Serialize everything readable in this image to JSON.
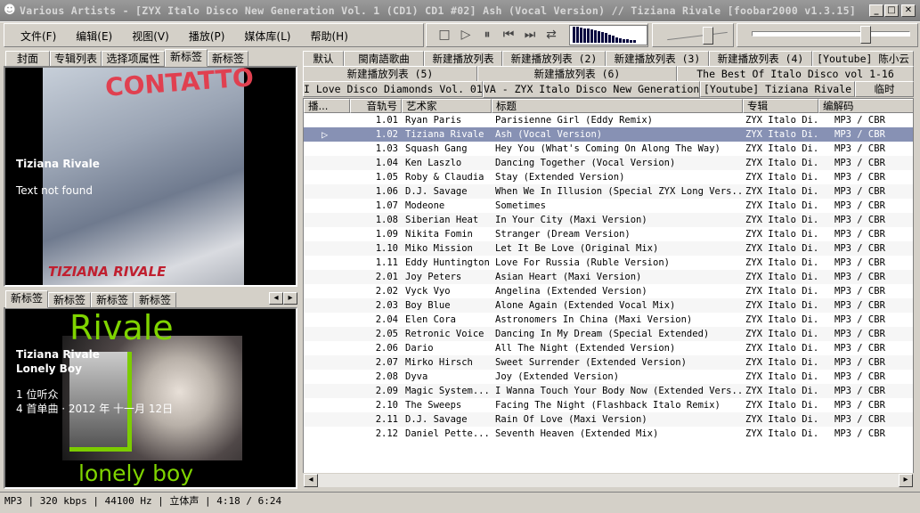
{
  "window": {
    "title": "Various Artists - [ZYX Italo Disco New Generation Vol. 1 (CD1) CD1 #02] Ash (Vocal Version) // Tiziana Rivale   [foobar2000 v1.3.15]"
  },
  "menu": [
    "文件(F)",
    "编辑(E)",
    "视图(V)",
    "播放(P)",
    "媒体库(L)",
    "帮助(H)"
  ],
  "left_tabs_top": [
    {
      "label": "封面"
    },
    {
      "label": "专辑列表"
    },
    {
      "label": "选择项属性"
    },
    {
      "label": "新标签",
      "active": true
    },
    {
      "label": "新标签"
    }
  ],
  "cover_overlay": {
    "artist": "Tiziana Rivale",
    "status": "Text not found"
  },
  "left_tabs_bottom": [
    {
      "label": "新标签",
      "active": true
    },
    {
      "label": "新标签"
    },
    {
      "label": "新标签"
    },
    {
      "label": "新标签"
    }
  ],
  "artist_panel": {
    "artist": "Tiziana Rivale",
    "track": "Lonely Boy",
    "listeners": "1 位听众",
    "info": "4 首单曲 · 2012 年 十一月 12日"
  },
  "playlist_tabs": {
    "row1": [
      "默认",
      "閩南語歌曲",
      "新建播放列表",
      "新建播放列表 (2)",
      "新建播放列表 (3)",
      "新建播放列表 (4)",
      "[Youtube] 陈小云"
    ],
    "row2": [
      "新建播放列表 (5)",
      "新建播放列表 (6)",
      "The Best Of Italo Disco vol 1-16"
    ],
    "row3": [
      "I Love Disco Diamonds Vol. 01",
      "VA - ZYX Italo Disco New Generation",
      "[Youtube] Tiziana Rivale",
      "临时"
    ],
    "active": "VA - ZYX Italo Disco New Generation"
  },
  "columns": [
    "播...",
    "音轨号",
    "艺术家",
    "标题",
    "专辑",
    "编解码"
  ],
  "tracks": [
    [
      "1.01",
      "Ryan Paris",
      "Parisienne Girl (Eddy Remix)"
    ],
    [
      "1.02",
      "Tiziana Rivale",
      "Ash (Vocal Version)"
    ],
    [
      "1.03",
      "Squash Gang",
      "Hey You (What's Coming On Along The Way)"
    ],
    [
      "1.04",
      "Ken Laszlo",
      "Dancing Together (Vocal Version)"
    ],
    [
      "1.05",
      "Roby & Claudia",
      "Stay (Extended Version)"
    ],
    [
      "1.06",
      "D.J. Savage",
      "When We In Illusion (Special ZYX Long Vers..."
    ],
    [
      "1.07",
      "Modeone",
      "Sometimes"
    ],
    [
      "1.08",
      "Siberian Heat",
      "In Your City (Maxi Version)"
    ],
    [
      "1.09",
      "Nikita Fomin",
      "Stranger (Dream Version)"
    ],
    [
      "1.10",
      "Miko Mission",
      "Let It Be Love (Original Mix)"
    ],
    [
      "1.11",
      "Eddy Huntington",
      "Love For Russia (Ruble Version)"
    ],
    [
      "2.01",
      "Joy Peters",
      "Asian Heart (Maxi Version)"
    ],
    [
      "2.02",
      "Vyck Vyo",
      "Angelina (Extended Version)"
    ],
    [
      "2.03",
      "Boy Blue",
      "Alone Again (Extended Vocal Mix)"
    ],
    [
      "2.04",
      "Elen Cora",
      "Astronomers In China (Maxi Version)"
    ],
    [
      "2.05",
      "Retronic Voice",
      "Dancing In My Dream (Special Extended)"
    ],
    [
      "2.06",
      "Dario",
      "All The Night (Extended Version)"
    ],
    [
      "2.07",
      "Mirko Hirsch",
      "Sweet Surrender (Extended Version)"
    ],
    [
      "2.08",
      "Dyva",
      "Joy (Extended Version)"
    ],
    [
      "2.09",
      "Magic System...",
      "I Wanna Touch Your Body Now (Extended Vers..."
    ],
    [
      "2.10",
      "The Sweeps",
      "Facing The Night (Flashback Italo Remix)"
    ],
    [
      "2.11",
      "D.J. Savage",
      "Rain Of Love (Maxi Version)"
    ],
    [
      "2.12",
      "Daniel Pette...",
      "Seventh Heaven (Extended Mix)"
    ]
  ],
  "album": "ZYX Italo Di...",
  "codec": "MP3 / CBR",
  "playing_index": 1,
  "cover_art": {
    "text_top": "CONTATTO",
    "text_bottom": "TIZIANA RIVALE"
  },
  "artist_art": {
    "text_top": "Rivale",
    "text_bottom": "lonely boy"
  },
  "volume": 0.75,
  "seek": 0.72,
  "status": "MP3 | 320 kbps | 44100 Hz | 立体声 | 4:18 / 6:24"
}
